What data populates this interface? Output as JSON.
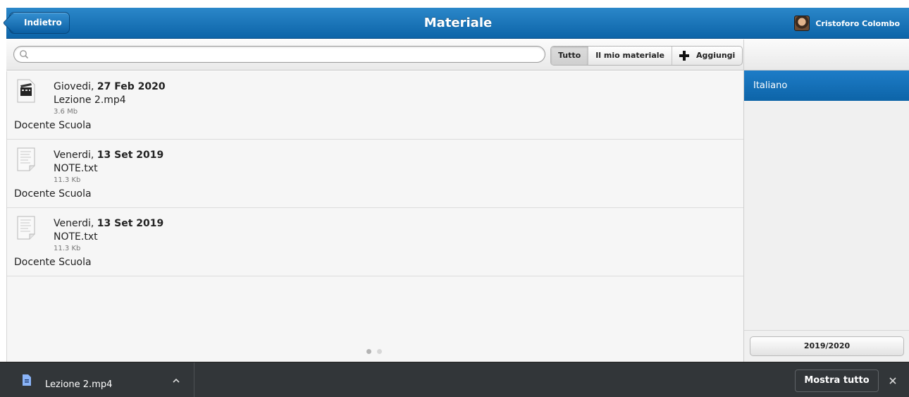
{
  "header": {
    "back_label": "Indietro",
    "title": "Materiale",
    "user_name": "Cristoforo Colombo"
  },
  "toolbar": {
    "search": {
      "value": "",
      "placeholder": ""
    },
    "segments": [
      "Tutto",
      "Il mio materiale"
    ],
    "active_segment": "Tutto",
    "add_label": "Aggiungi"
  },
  "files": [
    {
      "weekday": "Giovedi,",
      "date": "27 Feb 2020",
      "name": "Lezione 2.mp4",
      "size": "3.6 Mb",
      "owner": "Docente Scuola",
      "icon": "video-file-icon"
    },
    {
      "weekday": "Venerdi,",
      "date": "13 Set 2019",
      "name": "NOTE.txt",
      "size": "11.3 Kb",
      "owner": "Docente Scuola",
      "icon": "text-file-icon"
    },
    {
      "weekday": "Venerdi,",
      "date": "13 Set 2019",
      "name": "NOTE.txt",
      "size": "11.3 Kb",
      "owner": "Docente Scuola",
      "icon": "text-file-icon"
    }
  ],
  "pagination": {
    "pages": 2,
    "current": 1
  },
  "sidebar": {
    "subject": "Italiano",
    "year": "2019/2020"
  },
  "download_bar": {
    "file_name": "Lezione 2.mp4",
    "show_all_label": "Mostra tutto"
  },
  "colors": {
    "header_blue": "#0c64a8",
    "selected_blue": "#1d7cc7",
    "download_bar": "#323639"
  }
}
